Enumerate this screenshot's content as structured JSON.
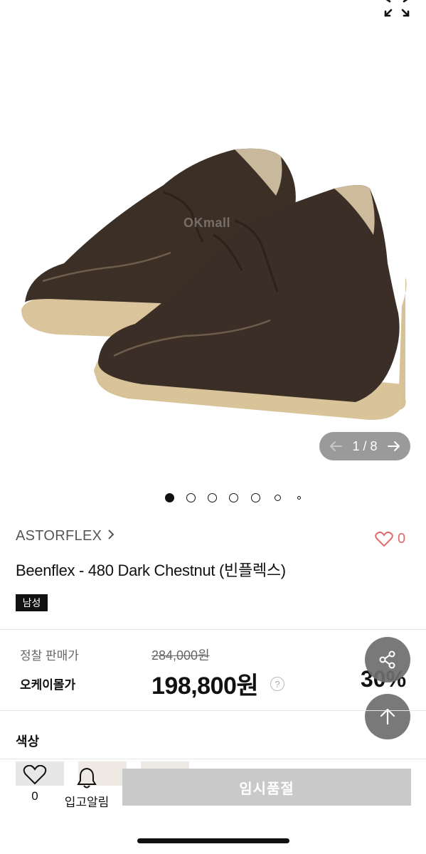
{
  "gallery": {
    "watermark": "OKmall",
    "current_page": 1,
    "total_pages": 8,
    "page_separator": "/",
    "dot_count": 7,
    "active_dot": 0
  },
  "product": {
    "brand": "ASTORFLEX",
    "title": "Beenflex - 480 Dark Chestnut (빈플렉스)",
    "gender_badge": "남성",
    "like_count": "0"
  },
  "price": {
    "regular_label": "정찰 판매가",
    "regular_price": "284,000원",
    "sale_label": "오케이몰가",
    "sale_price": "198,800원",
    "discount": "30%",
    "help_icon": "?"
  },
  "options": {
    "color_label": "색상"
  },
  "bottom_bar": {
    "like_count": "0",
    "alarm_label": "입고알림",
    "soldout_label": "임시품절"
  },
  "icons": {
    "expand": "expand-icon",
    "prev": "arrow-left-icon",
    "next": "arrow-right-icon",
    "heart": "heart-icon",
    "bell": "bell-icon",
    "share": "share-icon",
    "top": "arrow-up-icon"
  },
  "colors": {
    "heart_accent": "#e26a6a",
    "soldout_bg": "#c9c9c9",
    "fab_bg": "#6e6e6e"
  }
}
